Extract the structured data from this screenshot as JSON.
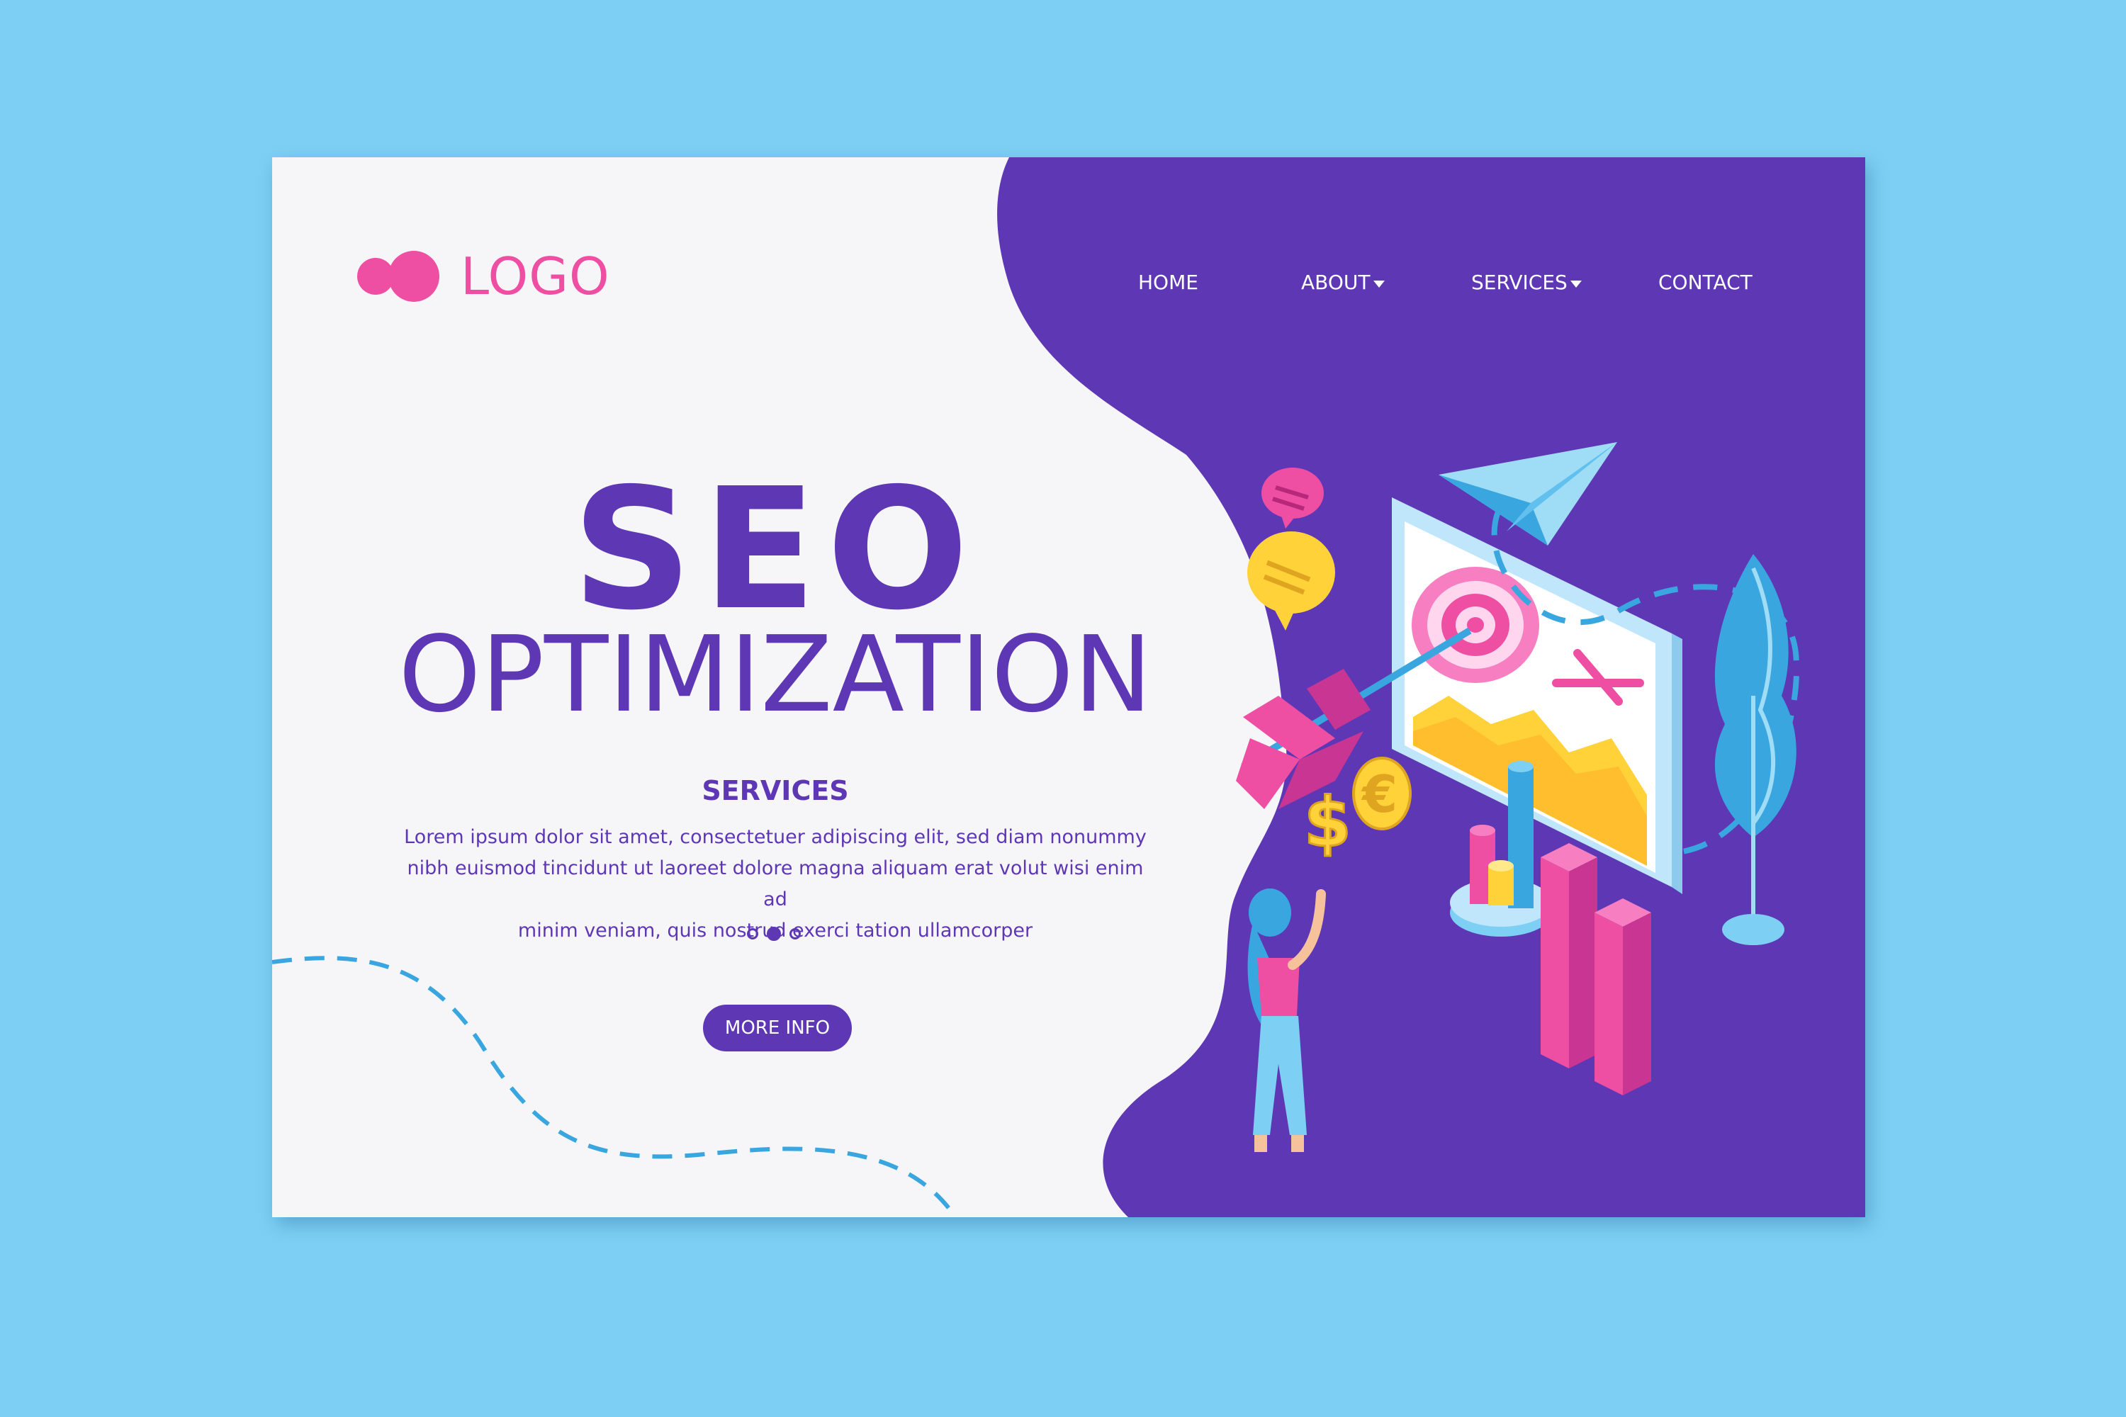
{
  "brand": {
    "logo_text": "LOGO"
  },
  "nav": {
    "items": [
      {
        "label": "HOME",
        "has_dropdown": false
      },
      {
        "label": "ABOUT",
        "has_dropdown": true
      },
      {
        "label": "SERVICES",
        "has_dropdown": true
      },
      {
        "label": "CONTACT",
        "has_dropdown": false
      }
    ]
  },
  "hero": {
    "title": "SEO",
    "subtitle": "OPTIMIZATION",
    "section_heading": "SERVICES",
    "body_lines": [
      "Lorem ipsum dolor sit amet, consectetuer adipiscing elit, sed diam nonummy",
      "nibh euismod tincidunt ut laoreet dolore magna aliquam erat volut wisi enim ad",
      "minim veniam, quis nostrud exerci tation ullamcorper"
    ],
    "carousel": {
      "count": 3,
      "active_index": 1
    },
    "cta_label": "MORE INFO"
  },
  "illustration": {
    "currency_symbols": [
      "$",
      "€"
    ]
  },
  "colors": {
    "page_background": "#7dd0f4",
    "card_background": "#f6f6f8",
    "purple": "#5e37b5",
    "pink": "#ee4fa3",
    "yellow": "#ffd23a",
    "blue": "#3aa6e0"
  },
  "icons": [
    "logo-mark-icon",
    "chevron-down-icon",
    "paper-plane-icon",
    "target-icon",
    "arrow-icon",
    "chat-bubble-icon",
    "dollar-coin-icon",
    "euro-coin-icon"
  ]
}
